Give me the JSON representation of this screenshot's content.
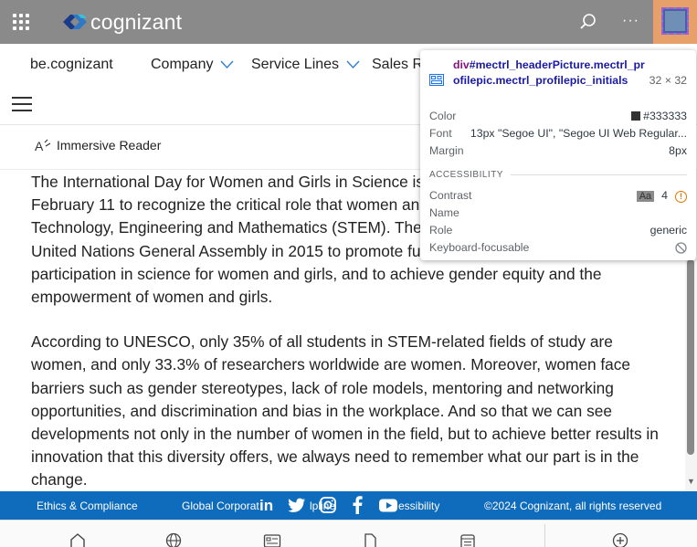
{
  "header": {
    "brand": "cognizant",
    "colors": {
      "bar": "#8a8a8a",
      "avatar_highlight": "#e8a06a"
    },
    "icons": [
      "app-launcher-icon",
      "search-icon",
      "more-icon",
      "profile-picture"
    ],
    "more_label": "···"
  },
  "sitenav": {
    "site_title": "be.cognizant",
    "items": [
      {
        "label": "Company"
      },
      {
        "label": "Service Lines"
      },
      {
        "label": "Sales Re"
      }
    ]
  },
  "command_bar": {
    "immersive_reader": "Immersive Reader"
  },
  "article": {
    "paragraphs": [
      "The International Day for Women and Girls in Science is celebrated every year on February 11 to recognize the critical role that women and girls play in Science, Technology, Engineering and Mathematics (STEM). The day was established by the United Nations General Assembly in 2015 to promote full and equal access to and participation in science for women and girls, and to achieve gender equity and the empowerment of women and girls.",
      "According to UNESCO, only 35% of all students in STEM-related fields of study are women, and only 33.3% of researchers worldwide are women. Moreover, women face barriers such as gender stereotypes, lack of role models, mentoring and networking opportunities, and discrimination and bias in the workplace. And so that we can see developments not only in the number of women in the field, but to achieve better results in innovation that this diversity offers, we always need to remember what our part is in the change."
    ]
  },
  "footer": {
    "ethics": "Ethics & Compliance",
    "global": "Global Corporat",
    "helpline_tail": "lpline",
    "accessibility_tail": "essibility",
    "copyright": "©2024 Cognizant, all rights reserved",
    "social": [
      "linkedin-icon",
      "twitter-icon",
      "instagram-icon",
      "facebook-icon",
      "youtube-icon"
    ],
    "color": "#0f6cbd"
  },
  "tabbar": {
    "icons": [
      "home-icon",
      "globe-icon",
      "news-icon",
      "document-icon",
      "feed-icon",
      "add-icon"
    ]
  },
  "inspect_tooltip": {
    "tag": "div",
    "selector": "#mectrl_headerPicture.mectrl_profilepic.mectrl_profilepic_initials",
    "dims": "32 × 32",
    "color_label": "Color",
    "color_value": "#333333",
    "font_label": "Font",
    "font_value": "13px \"Segoe UI\", \"Segoe UI Web Regular...",
    "margin_label": "Margin",
    "margin_value": "8px",
    "accessibility_heading": "ACCESSIBILITY",
    "contrast_label": "Contrast",
    "contrast_aa": "Aa",
    "contrast_value": "4",
    "warning_mark": "!",
    "name_label": "Name",
    "role_label": "Role",
    "role_value": "generic",
    "focusable_label": "Keyboard-focusable"
  }
}
